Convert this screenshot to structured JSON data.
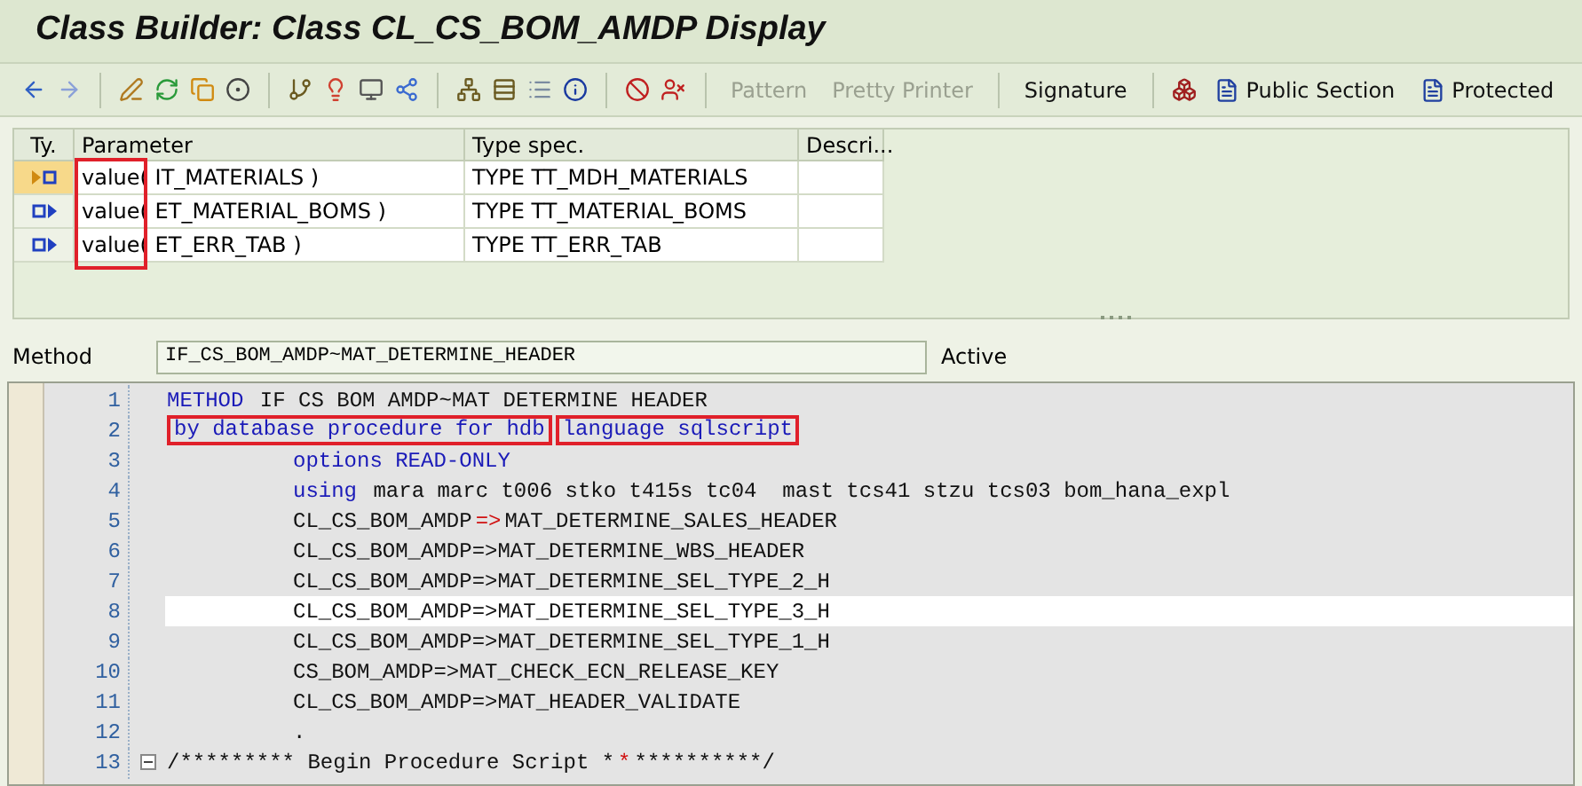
{
  "window": {
    "title": "Class Builder: Class CL_CS_BOM_AMDP Display"
  },
  "toolbar": {
    "buttons": [
      {
        "label": "Pattern",
        "disabled": true
      },
      {
        "label": "Pretty Printer",
        "disabled": true
      },
      {
        "label": "Signature",
        "disabled": false
      },
      {
        "label": "Public Section",
        "disabled": false,
        "icon": true
      },
      {
        "label": "Protected",
        "disabled": false,
        "icon": true
      }
    ]
  },
  "parameters": {
    "columns": [
      "Ty.",
      "Parameter",
      "Type spec.",
      "Descri..."
    ],
    "rows": [
      {
        "kind": "importing",
        "selected": true,
        "prefix": "value(",
        "name": " IT_MATERIALS )",
        "type": "TYPE TT_MDH_MATERIALS"
      },
      {
        "kind": "exporting",
        "selected": false,
        "prefix": "value(",
        "name": " ET_MATERIAL_BOMS )",
        "type": "TYPE TT_MATERIAL_BOMS"
      },
      {
        "kind": "exporting",
        "selected": false,
        "prefix": "value(",
        "name": " ET_ERR_TAB )",
        "type": "TYPE TT_ERR_TAB"
      }
    ]
  },
  "method": {
    "label": "Method",
    "value": "IF_CS_BOM_AMDP~MAT_DETERMINE_HEADER",
    "status": "Active"
  },
  "code": [
    {
      "number": "1",
      "selected": false,
      "kind": "statement",
      "segments": [
        {
          "kind": "keyword",
          "text": "METHOD "
        },
        {
          "kind": "plain",
          "text": "IF CS BOM AMDP~MAT DETERMINE HEADER"
        }
      ]
    },
    {
      "number": "2",
      "selected": false,
      "kind": "statement",
      "segments": [
        {
          "kind": "keyword",
          "text": "by database procedure for hdb",
          "boxed": true
        },
        {
          "kind": "keyword",
          "text": "language sqlscript",
          "boxed": true
        }
      ]
    },
    {
      "number": "3",
      "selected": false,
      "kind": "continuation",
      "segments": [
        {
          "kind": "keyword",
          "text": "options READ-ONLY"
        }
      ]
    },
    {
      "number": "4",
      "selected": false,
      "kind": "continuation",
      "segments": [
        {
          "kind": "keyword",
          "text": "using "
        },
        {
          "kind": "plain",
          "text": "mara marc t006 stko t415s tc04  mast tcs41 stzu tcs03 bom_hana_expl"
        }
      ]
    },
    {
      "number": "5",
      "selected": false,
      "kind": "continuation",
      "segments": [
        {
          "kind": "plain",
          "text": "CL_CS_BOM_AMDP"
        },
        {
          "kind": "operator",
          "text": "=>"
        },
        {
          "kind": "plain",
          "text": "MAT_DETERMINE_SALES_HEADER"
        }
      ]
    },
    {
      "number": "6",
      "selected": false,
      "kind": "continuation",
      "segments": [
        {
          "kind": "plain",
          "text": "CL_CS_BOM_AMDP=>MAT_DETERMINE_WBS_HEADER"
        }
      ]
    },
    {
      "number": "7",
      "selected": false,
      "kind": "continuation",
      "segments": [
        {
          "kind": "plain",
          "text": "CL_CS_BOM_AMDP=>MAT_DETERMINE_SEL_TYPE_2_H"
        }
      ]
    },
    {
      "number": "8",
      "selected": true,
      "kind": "continuation",
      "segments": [
        {
          "kind": "plain",
          "text": "CL_CS_BOM_AMDP=>MAT_DETERMINE_SEL_TYPE_3_H"
        }
      ]
    },
    {
      "number": "9",
      "selected": false,
      "kind": "continuation",
      "segments": [
        {
          "kind": "plain",
          "text": "CL_CS_BOM_AMDP=>MAT_DETERMINE_SEL_TYPE_1_H"
        }
      ]
    },
    {
      "number": "10",
      "selected": false,
      "kind": "continuation",
      "segments": [
        {
          "kind": "plain",
          "text": "CS_BOM_AMDP=>MAT_CHECK_ECN_RELEASE_KEY"
        }
      ]
    },
    {
      "number": "11",
      "selected": false,
      "kind": "continuation",
      "segments": [
        {
          "kind": "plain",
          "text": "CL_CS_BOM_AMDP=>MAT_HEADER_VALIDATE"
        }
      ]
    },
    {
      "number": "12",
      "selected": false,
      "kind": "continuation",
      "segments": [
        {
          "kind": "plain",
          "text": "."
        }
      ]
    },
    {
      "number": "13",
      "selected": false,
      "kind": "statement",
      "fold": true,
      "segments": [
        {
          "kind": "plain",
          "text": "/********* Begin Procedure Script *"
        },
        {
          "kind": "operator",
          "text": "*"
        },
        {
          "kind": "plain",
          "text": "**********/"
        }
      ]
    }
  ]
}
